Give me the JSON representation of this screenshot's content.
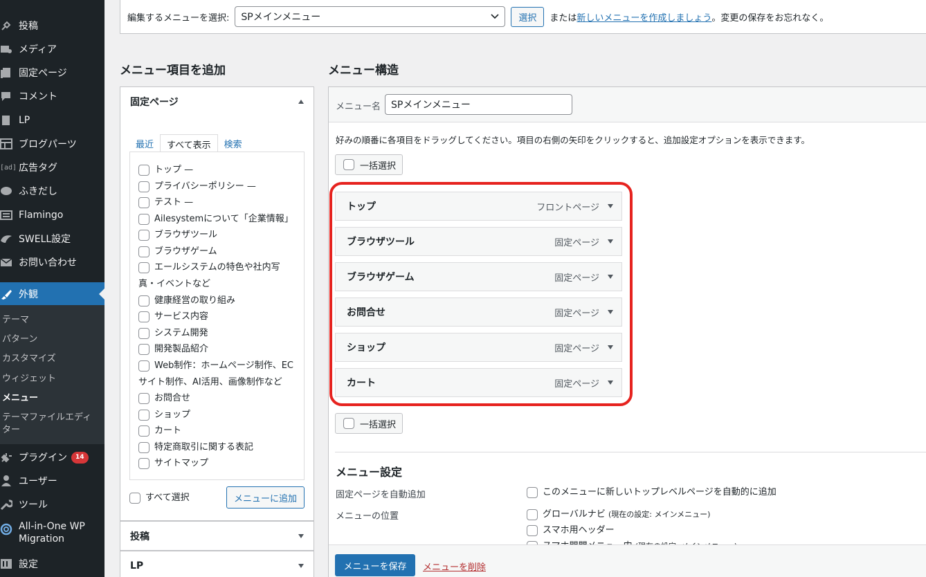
{
  "sidebar": {
    "items": [
      {
        "label": "投稿",
        "icon": "pin-icon"
      },
      {
        "label": "メディア",
        "icon": "media-icon"
      },
      {
        "label": "固定ページ",
        "icon": "page-icon"
      },
      {
        "label": "コメント",
        "icon": "comment-icon"
      },
      {
        "label": "LP",
        "icon": "lp-icon"
      },
      {
        "label": "ブログパーツ",
        "icon": "grid-icon"
      },
      {
        "label": "広告タグ",
        "icon": "ad-icon"
      },
      {
        "label": "ふきだし",
        "icon": "balloon-icon"
      },
      {
        "label": "Flamingo",
        "icon": "inbox-icon"
      },
      {
        "label": "SWELL設定",
        "icon": "swell-icon"
      },
      {
        "label": "お問い合わせ",
        "icon": "mail-icon"
      },
      {
        "label": "外観",
        "icon": "brush-icon"
      },
      {
        "label": "プラグイン",
        "icon": "plugin-icon",
        "badge": "14"
      },
      {
        "label": "ユーザー",
        "icon": "user-icon"
      },
      {
        "label": "ツール",
        "icon": "wrench-icon"
      },
      {
        "label": "All-in-One WP Migration",
        "icon": "migration-icon"
      },
      {
        "label": "設定",
        "icon": "settings-icon"
      }
    ],
    "ad_icon_text": "[ad]",
    "submenu": [
      "テーマ",
      "パターン",
      "カスタマイズ",
      "ウィジェット",
      "メニュー",
      "テーマファイルエディター"
    ]
  },
  "select_bar": {
    "label": "編集するメニューを選択:",
    "selected": "SPメインメニュー",
    "button": "選択",
    "text_or": "または",
    "link": "新しいメニューを作成しましょう",
    "text_after": "。変更の保存をお忘れなく。"
  },
  "left": {
    "heading": "メニュー項目を追加",
    "section_pages": "固定ページ",
    "tabs": [
      "最近",
      "すべて表示",
      "検索"
    ],
    "pages": [
      "トップ —",
      "プライバシーポリシー —",
      "テスト —",
      "Ailesystemについて「企業情報」",
      "ブラウザツール",
      "ブラウザゲーム",
      "エールシステムの特色や社内写",
      "真・イベントなど",
      "健康経営の取り組み",
      "サービス内容",
      "システム開発",
      "開発製品紹介",
      "Web制作：ホームページ制作、EC",
      "サイト制作、AI活用、画像制作など",
      "お問合せ",
      "ショップ",
      "カート",
      "特定商取引に関する表記",
      "サイトマップ"
    ],
    "select_all": "すべて選択",
    "add_button": "メニューに追加",
    "section_posts": "投稿",
    "section_lp": "LP"
  },
  "right": {
    "heading": "メニュー構造",
    "name_label": "メニュー名",
    "name_value": "SPメインメニュー",
    "instructions": "好みの順番に各項目をドラッグしてください。項目の右側の矢印をクリックすると、追加設定オプションを表示できます。",
    "bulk_select": "一括選択",
    "items": [
      {
        "title": "トップ",
        "type": "フロントページ"
      },
      {
        "title": "ブラウザツール",
        "type": "固定ページ"
      },
      {
        "title": "ブラウザゲーム",
        "type": "固定ページ"
      },
      {
        "title": "お問合せ",
        "type": "固定ページ"
      },
      {
        "title": "ショップ",
        "type": "固定ページ"
      },
      {
        "title": "カート",
        "type": "固定ページ"
      }
    ],
    "settings_heading": "メニュー設定",
    "auto_add_label": "固定ページを自動追加",
    "auto_add_option": "このメニューに新しいトップレベルページを自動的に追加",
    "location_label": "メニューの位置",
    "locations": [
      {
        "name": "グローバルナビ",
        "note": "(現在の設定: メインメニュー)"
      },
      {
        "name": "スマホ用ヘッダー",
        "note": ""
      },
      {
        "name": "スマホ開閉メニュー内",
        "note": "(現在の設定: メインメニュー)"
      }
    ],
    "save_button": "メニューを保存",
    "delete_link": "メニューを削除"
  },
  "colors": {
    "highlight": "#e6231f",
    "primary": "#2271b1",
    "sidebar_bg": "#1d2327"
  }
}
